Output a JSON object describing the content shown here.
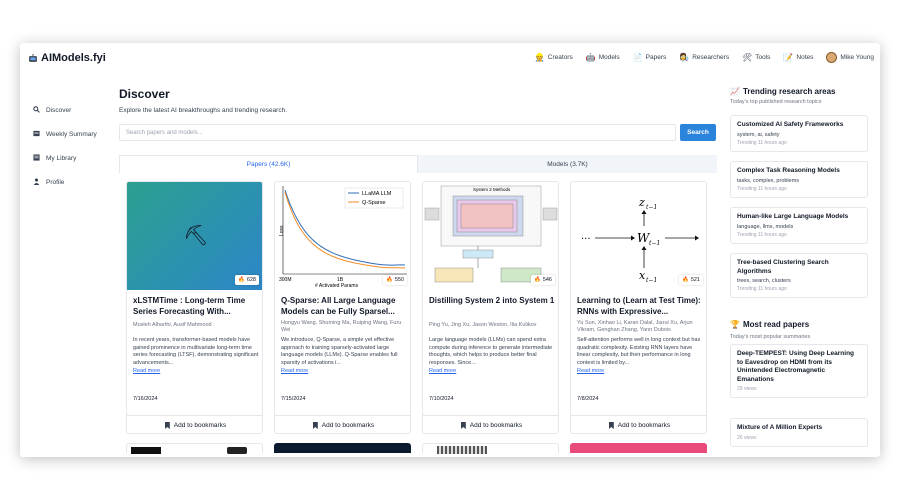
{
  "brand": {
    "name": "AIModels.fyi"
  },
  "nav": [
    {
      "label": "Creators",
      "icon": "construction-worker-icon",
      "glyph": "👷"
    },
    {
      "label": "Models",
      "icon": "robot-icon",
      "glyph": "🤖"
    },
    {
      "label": "Papers",
      "icon": "document-icon",
      "glyph": "📄"
    },
    {
      "label": "Researchers",
      "icon": "scientist-icon",
      "glyph": "👩‍🔬"
    },
    {
      "label": "Tools",
      "icon": "tools-icon",
      "glyph": "🛠"
    },
    {
      "label": "Notes",
      "icon": "notepad-icon",
      "glyph": "📝"
    }
  ],
  "user": {
    "name": "Mike Young"
  },
  "sidebar": {
    "items": [
      {
        "label": "Discover",
        "icon": "search-icon",
        "glyph": "🔍"
      },
      {
        "label": "Weekly Summary",
        "icon": "calendar-icon",
        "glyph": "▤"
      },
      {
        "label": "My Library",
        "icon": "library-icon",
        "glyph": "▥"
      },
      {
        "label": "Profile",
        "icon": "user-icon",
        "glyph": "👤"
      }
    ]
  },
  "main": {
    "title": "Discover",
    "subtitle": "Explore the latest AI breakthroughs and trending research.",
    "search": {
      "placeholder": "Search papers and models...",
      "button": "Search"
    },
    "tabs": [
      {
        "label": "Papers (42.6K)"
      },
      {
        "label": "Models (3.7K)"
      }
    ],
    "cards": [
      {
        "title": "xLSTMTime : Long-term Time Series Forecasting With...",
        "authors": "Musleh Alharthi, Ausif Mahmood",
        "abstract": "In recent years, transformer-based models have gained prominence in multivariate long-term time series forecasting (LTSF), demonstrating significant advancements...",
        "read_more": "Read more",
        "date": "7/16/2024",
        "count": "628",
        "bookmark": "Add to bookmarks"
      },
      {
        "title": "Q-Sparse: All Large Language Models can be Fully Sparsel...",
        "authors": "Hongyu Wang, Shuming Ma, Ruiping Wang, Furu Wei",
        "abstract": "We introduce, Q-Sparse, a simple yet effective approach to training sparsely-activated large language models (LLMs). Q-Sparse enables full sparsity of activations i...",
        "read_more": "Read more",
        "date": "7/15/2024",
        "count": "550",
        "bookmark": "Add to bookmarks",
        "chart": {
          "legend": [
            "LLaMA LLM",
            "Q-Sparse"
          ],
          "ylabel": "Loss",
          "xlabel": "# Activated Params",
          "xticks": [
            "300M",
            "1B",
            "7B"
          ]
        }
      },
      {
        "title": "Distilling System 2 into System 1",
        "authors": "Ping Yu, Jing Xu, Jason Weston, Ilia Kulikov",
        "abstract": "Large language models (LLMs) can spend extra compute during inference to generate intermediate thoughts, which helps to produce better final responses. Since...",
        "read_more": "Read more",
        "date": "7/10/2024",
        "count": "546",
        "bookmark": "Add to bookmarks",
        "diagram_label": "System 2 Methods"
      },
      {
        "title": "Learning to (Learn at Test Time): RNNs with Expressive...",
        "authors": "Yu Sun, Xinhao Li, Karan Dalal, Jiarui Xu, Arjun Vikram, Genghan Zhang, Yann Dubois",
        "abstract": "Self-attention performs well in long context but has quadratic complexity. Existing RNN layers have linear complexity, but their performance in long context is limited by...",
        "read_more": "Read more",
        "date": "7/8/2024",
        "count": "521",
        "bookmark": "Add to bookmarks",
        "math": {
          "top": "z",
          "top_sub": "t−1",
          "mid": "W",
          "mid_sub": "t−1",
          "bot": "x",
          "bot_sub": "t−1",
          "dots": "···"
        }
      }
    ]
  },
  "right": {
    "trending": {
      "title": "Trending research areas",
      "subtitle": "Today's top published research topics",
      "items": [
        {
          "title": "Customized AI Safety Frameworks",
          "keywords": "system, ai, safety",
          "meta": "Trending 11 hours ago"
        },
        {
          "title": "Complex Task Reasoning Models",
          "keywords": "tasks, complex, problems",
          "meta": "Trending 11 hours ago"
        },
        {
          "title": "Human-like Large Language Models",
          "keywords": "language, llms, models",
          "meta": "Trending 11 hours ago"
        },
        {
          "title": "Tree-based Clustering Search Algorithms",
          "keywords": "trees, search, clusters",
          "meta": "Trending 11 hours ago"
        }
      ]
    },
    "most_read": {
      "title": "Most read papers",
      "subtitle": "Today's most popular summaries",
      "items": [
        {
          "title": "Deep-TEMPEST: Using Deep Learning to Eavesdrop on HDMI from its Unintended Electromagnetic Emanations",
          "meta": "29 views"
        },
        {
          "title": "Mixture of A Million Experts",
          "meta": "26 views"
        }
      ]
    }
  }
}
